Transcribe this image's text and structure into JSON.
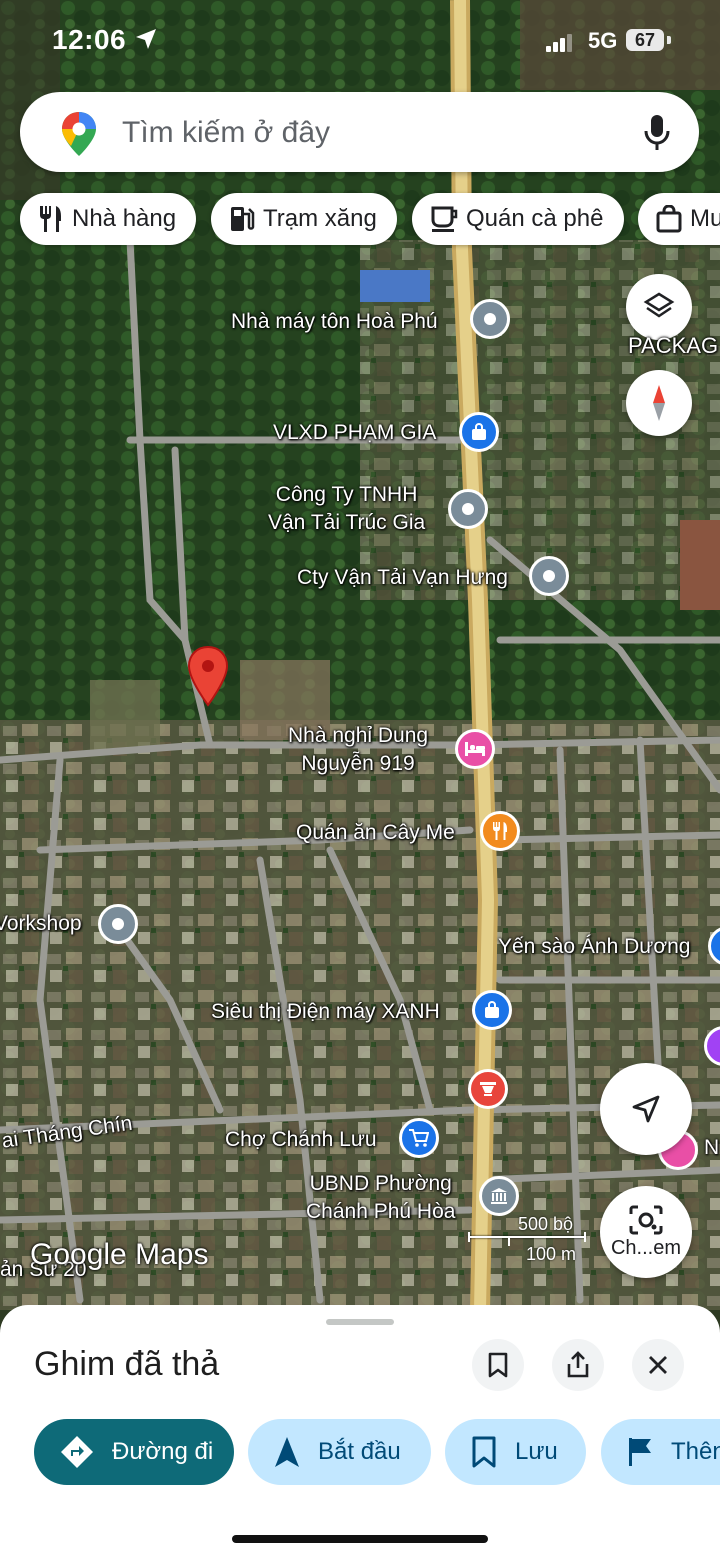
{
  "status_bar": {
    "time": "12:06",
    "network": "5G",
    "battery": "67"
  },
  "search": {
    "placeholder": "Tìm kiếm ở đây"
  },
  "chips": [
    {
      "label": "Nhà hàng",
      "icon": "restaurant-icon"
    },
    {
      "label": "Trạm xăng",
      "icon": "gas-station-icon"
    },
    {
      "label": "Quán cà phê",
      "icon": "coffee-icon"
    },
    {
      "label": "Mu",
      "icon": "shopping-bag-icon"
    }
  ],
  "map": {
    "labels": {
      "nha_may": "Nhà máy tôn Hoà Phú",
      "package_fragment": "PACKAG",
      "vlxd": "VLXD PHẠM GIA",
      "cong_ty_line1": "Công Ty TNHH",
      "cong_ty_line2": "Vận Tải Trúc Gia",
      "cty_van_hung": "Cty Vận Tải Vạn Hưng",
      "nha_nghi_line1": "Nhà nghỉ Dung",
      "nha_nghi_line2": "Nguyễn 919",
      "quan_an": "Quán ăn Cây Me",
      "workshop": "Vorkshop",
      "yen_sao": "Yến sào Ánh Dương",
      "sieu_thi": "Siêu thị Điện máy XANH",
      "thang_chin": "ai Tháng Chín",
      "cho": "Chợ Chánh Lưu",
      "n_fragment": "N",
      "ubnd_line1": "UBND Phường",
      "ubnd_line2": "Chánh Phú Hòa",
      "su_fragment": "ản Sư 20"
    },
    "attribution": {
      "google": "Google",
      "maps": "Maps"
    },
    "scale": {
      "top": "500 bộ",
      "bottom": "100 m"
    },
    "lens_label": "Ch...em"
  },
  "sheet": {
    "title": "Ghim đã thả",
    "actions": [
      {
        "label": "Đường đi",
        "icon": "directions-icon"
      },
      {
        "label": "Bắt đầu",
        "icon": "navigation-icon"
      },
      {
        "label": "Lưu",
        "icon": "bookmark-icon"
      },
      {
        "label": "Thên",
        "icon": "flag-icon"
      }
    ]
  },
  "colors": {
    "pin_red": "#ea4335",
    "poi_blue": "#1a73e8",
    "poi_gray": "#7a8c99",
    "poi_pink": "#e94fa6",
    "poi_orange": "#f28b1e",
    "primary_action": "#0e6a78",
    "secondary_action": "#c2e7ff"
  }
}
